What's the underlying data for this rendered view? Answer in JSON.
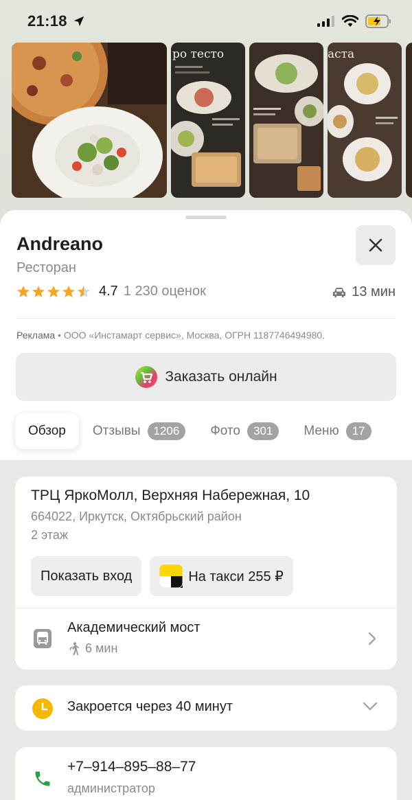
{
  "status": {
    "time": "21:18"
  },
  "place": {
    "title": "Andreano",
    "subtitle": "Ресторан",
    "rating": "4.7",
    "rating_count": "1 230 оценок",
    "drive_time": "13 мин",
    "ad_label": "Реклама",
    "ad_text": " • ООО «Инстамарт сервис», Москва, ОГРН 1187746494980."
  },
  "order": {
    "label": "Заказать онлайн"
  },
  "tabs": [
    {
      "label": "Обзор"
    },
    {
      "label": "Отзывы",
      "badge": "1206"
    },
    {
      "label": "Фото",
      "badge": "301"
    },
    {
      "label": "Меню",
      "badge": "17"
    }
  ],
  "address": {
    "main": "ТРЦ ЯркоМолл, Верхняя Набережная, 10",
    "sub": "664022, Иркутск, Октябрьский район",
    "floor": "2 этаж",
    "show_entrance": "Показать вход",
    "taxi": "На такси 255 ₽"
  },
  "transit": {
    "stop": "Академический мост",
    "walk": "6 мин"
  },
  "hours": {
    "text": "Закроется через 40 минут"
  },
  "phone": {
    "number": "+7‒914‒895‒88‒77",
    "role": "администратор"
  },
  "colors": {
    "star": "#f5a623",
    "phone_green": "#27a046",
    "clock_yellow": "#f5b800"
  }
}
